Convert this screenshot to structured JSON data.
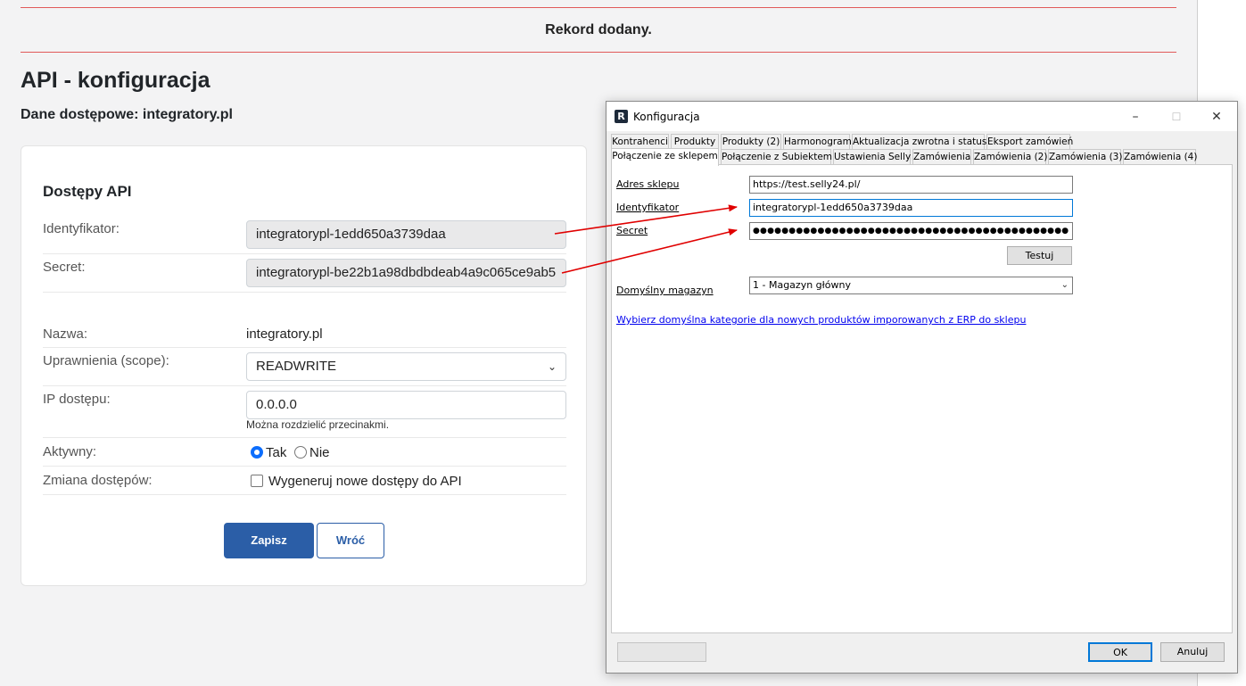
{
  "alert": {
    "text": "Rekord dodany."
  },
  "page": {
    "title": "API - konfiguracja",
    "subtitle": "Dane dostępowe: integratory.pl"
  },
  "card": {
    "title": "Dostępy API",
    "identifier_label": "Identyfikator:",
    "identifier_value": "integratorypl-1edd650a3739daa",
    "secret_label": "Secret:",
    "secret_value": "integratorypl-be22b1a98dbdbdeab4a9c065ce9ab5",
    "name_label": "Nazwa:",
    "name_value": "integratory.pl",
    "scope_label": "Uprawnienia (scope):",
    "scope_value": "READWRITE",
    "ip_label": "IP dostępu:",
    "ip_value": "0.0.0.0",
    "ip_hint": "Można rozdzielić przecinakmi.",
    "active_label": "Aktywny:",
    "active_yes": "Tak",
    "active_no": "Nie",
    "active_selected": "Tak",
    "change_label": "Zmiana dostępów:",
    "regenerate_label": "Wygeneruj nowe dostępy do API",
    "regenerate_checked": false,
    "save_label": "Zapisz",
    "back_label": "Wróć"
  },
  "dialog": {
    "title": "Konfiguracja",
    "app_icon_letter": "R",
    "minimize_glyph": "–",
    "maximize_glyph": "☐",
    "close_glyph": "✕",
    "tabs_row1": [
      "Kontrahenci",
      "Produkty",
      "Produkty (2)",
      "Harmonogram",
      "Aktualizacja zwrotna i statusy",
      "Eksport zamówień"
    ],
    "tabs_row2": [
      "Połączenie ze sklepem",
      "Połączenie z Subiektem",
      "Ustawienia Selly",
      "Zamówienia",
      "Zamówienia (2)",
      "Zamówienia (3)",
      "Zamówienia (4)"
    ],
    "active_tab": "Połączenie ze sklepem",
    "shop_address_label": "Adres sklepu",
    "shop_address_value": "https://test.selly24.pl/",
    "identifier_label": "Identyfikator",
    "identifier_value": "integratorypl-1edd650a3739daa",
    "secret_label": "Secret",
    "secret_value": "●●●●●●●●●●●●●●●●●●●●●●●●●●●●●●●●●●●●●●●●●●●●",
    "test_button": "Testuj",
    "warehouse_label": "Domyślny magazyn",
    "warehouse_value": "1 - Magazyn główny",
    "category_link": "Wybierz domyślna kategorie dla nowych produktów imporowanych z ERP do sklepu",
    "ok_button": "OK",
    "cancel_button": "Anuluj"
  },
  "colors": {
    "alert_line": "#e15a5a",
    "primary": "#2b5ea7",
    "arrow": "#e00000",
    "link": "#0000ee"
  }
}
